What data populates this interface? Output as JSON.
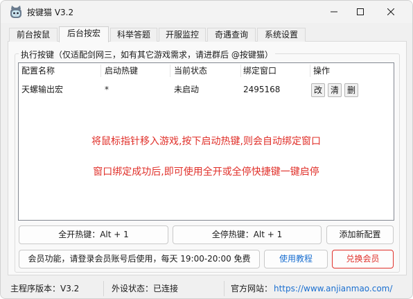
{
  "window": {
    "title": "按键猫 V3.2"
  },
  "tabs": [
    {
      "label": "前台按鼠"
    },
    {
      "label": "后台按宏"
    },
    {
      "label": "科举答题"
    },
    {
      "label": "开服监控"
    },
    {
      "label": "奇遇查询"
    },
    {
      "label": "系统设置"
    }
  ],
  "group": {
    "legend": "执行按键（仅适配剑网三，如有其它游戏需求，请进群后 @按键猫）"
  },
  "table": {
    "headers": [
      "配置名称",
      "启动热键",
      "当前状态",
      "绑定窗口",
      "操作"
    ],
    "rows": [
      {
        "name": "天螺输出宏",
        "hotkey": "*",
        "status": "未启动",
        "window": "2495168",
        "actions": [
          "改",
          "清",
          "删"
        ]
      }
    ]
  },
  "notice": {
    "line1": "将鼠标指针移入游戏,按下启动热键,则会自动绑定窗口",
    "line2": "窗口绑定成功后,即可使用全开或全停快捷键一键启停"
  },
  "buttons": {
    "start_all": "全开热键：Alt + 1",
    "stop_all": "全停热键：Alt + 1",
    "add_config": "添加新配置",
    "member_info": "会员功能，请登录会员账号后使用，每天 19:00-20:00 免费",
    "tutorial": "使用教程",
    "redeem": "兑换会员"
  },
  "status_bar": {
    "version": "主程序版本：V3.2",
    "device": "外设状态：已连接",
    "site_label": "官方网站：",
    "site_url": "https://www.anjianmao.com/"
  },
  "colors": {
    "accent_red": "#e0302a",
    "accent_blue": "#1a6fd0"
  }
}
